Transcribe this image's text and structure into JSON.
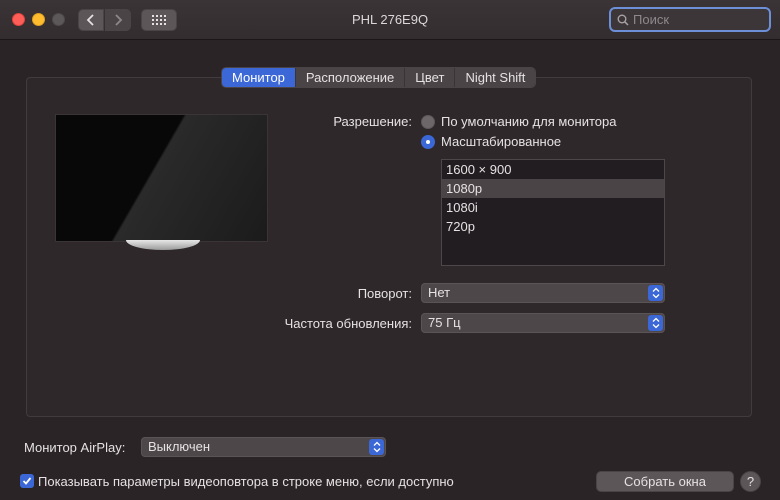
{
  "window": {
    "title": "PHL 276E9Q",
    "search_placeholder": "Поиск"
  },
  "tabs": [
    {
      "label": "Монитор",
      "active": true
    },
    {
      "label": "Расположение",
      "active": false
    },
    {
      "label": "Цвет",
      "active": false
    },
    {
      "label": "Night Shift",
      "active": false
    }
  ],
  "resolution": {
    "label": "Разрешение:",
    "options": [
      {
        "label": "По умолчанию для монитора",
        "selected": false
      },
      {
        "label": "Масштабированное",
        "selected": true
      }
    ],
    "list": [
      {
        "label": "1600 × 900",
        "selected": false
      },
      {
        "label": "1080p",
        "selected": true
      },
      {
        "label": "1080i",
        "selected": false
      },
      {
        "label": "720p",
        "selected": false
      }
    ]
  },
  "rotation": {
    "label": "Поворот:",
    "value": "Нет"
  },
  "refresh": {
    "label": "Частота обновления:",
    "value": "75 Гц"
  },
  "airplay": {
    "label": "Монитор AirPlay:",
    "value": "Выключен"
  },
  "mirroring_checkbox": {
    "label": "Показывать параметры видеоповтора в строке меню, если доступно",
    "checked": true
  },
  "gather_button": "Собрать окна",
  "help_button": "?",
  "colors": {
    "accent": "#3b68d6",
    "background": "#2a2427"
  }
}
